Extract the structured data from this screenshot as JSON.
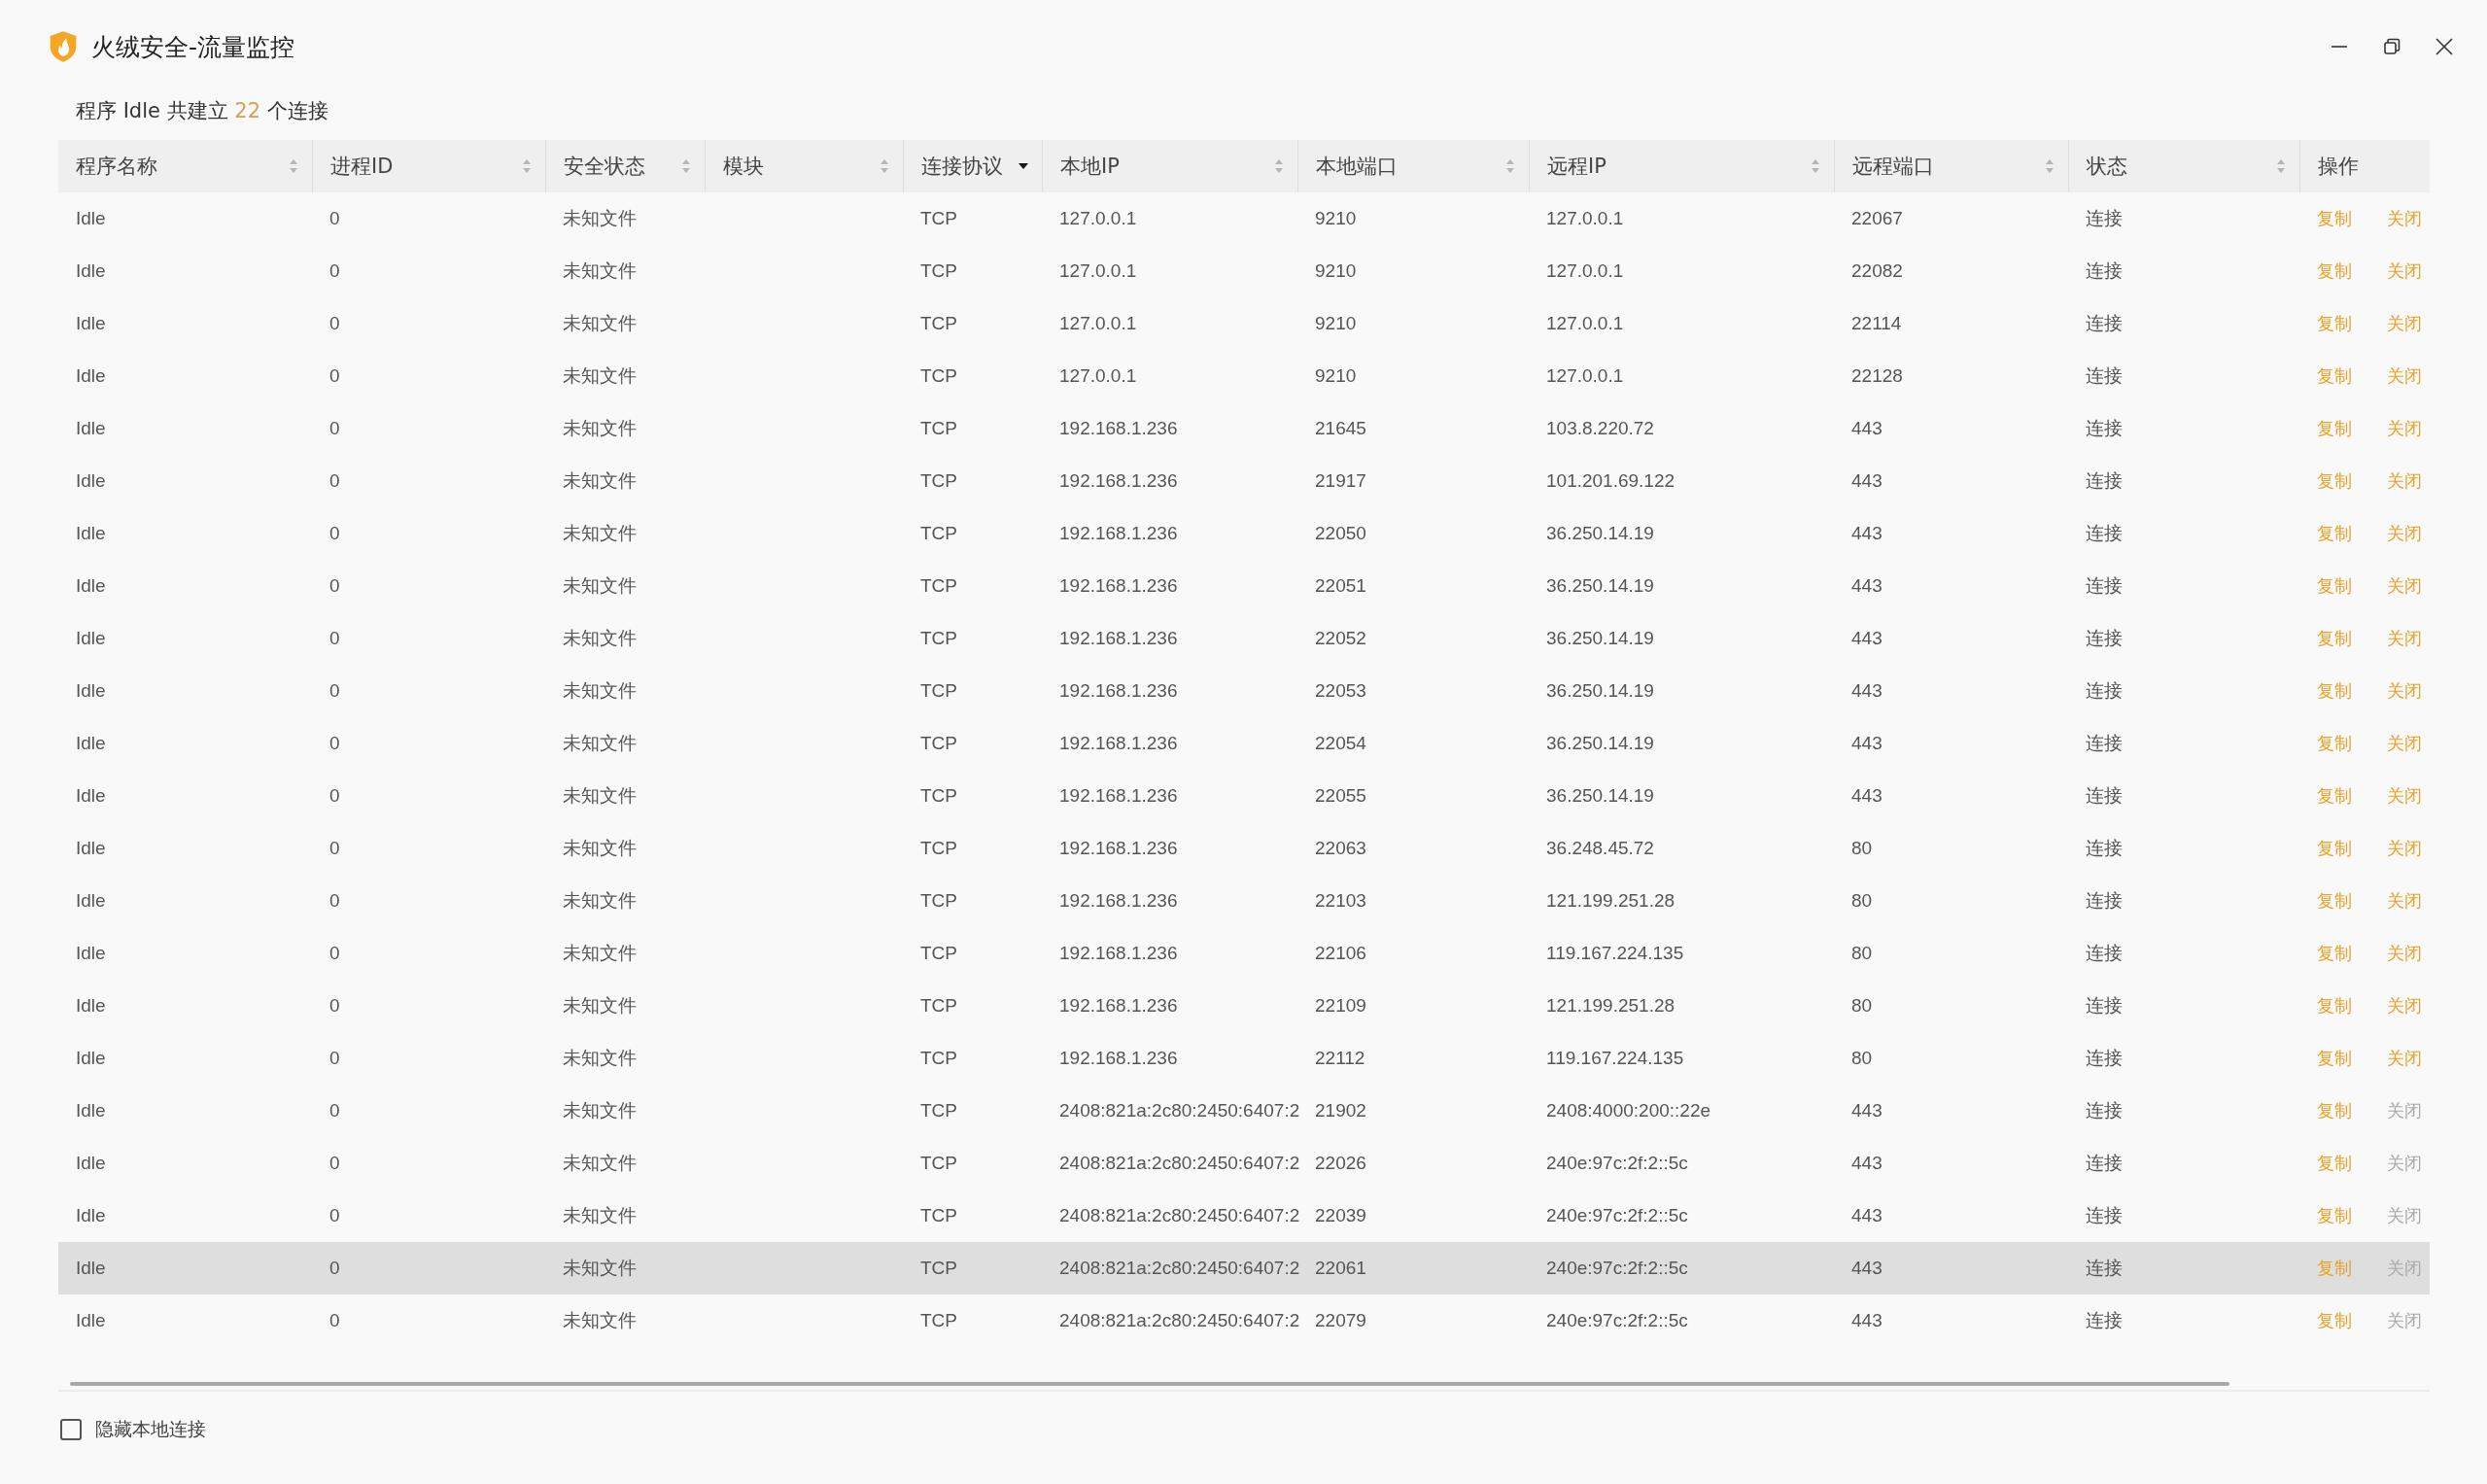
{
  "window": {
    "title": "火绒安全-流量监控"
  },
  "summary": {
    "prefix": "程序 Idle 共建立",
    "count": "22",
    "suffix": "个连接"
  },
  "table": {
    "columns": [
      {
        "label": "程序名称",
        "kind": "sortable",
        "sorted_descending": false
      },
      {
        "label": "进程ID",
        "kind": "sortable",
        "sorted_descending": false
      },
      {
        "label": "安全状态",
        "kind": "sortable",
        "sorted_descending": false
      },
      {
        "label": "模块",
        "kind": "sortable",
        "sorted_descending": false
      },
      {
        "label": "连接协议",
        "kind": "sortable",
        "sorted_descending": true
      },
      {
        "label": "本地IP",
        "kind": "sortable",
        "sorted_descending": false
      },
      {
        "label": "本地端口",
        "kind": "sortable",
        "sorted_descending": false
      },
      {
        "label": "远程IP",
        "kind": "sortable",
        "sorted_descending": false
      },
      {
        "label": "远程端口",
        "kind": "sortable",
        "sorted_descending": false
      },
      {
        "label": "状态",
        "kind": "sortable",
        "sorted_descending": false
      },
      {
        "label": "操作",
        "kind": "plain"
      }
    ],
    "rows": [
      {
        "cells": [
          "Idle",
          "0",
          "未知文件",
          "",
          "TCP",
          "127.0.0.1",
          "9210",
          "127.0.0.1",
          "22067",
          "连接"
        ],
        "copy": "复制",
        "close": "关闭",
        "close_disabled": false,
        "selected": false
      },
      {
        "cells": [
          "Idle",
          "0",
          "未知文件",
          "",
          "TCP",
          "127.0.0.1",
          "9210",
          "127.0.0.1",
          "22082",
          "连接"
        ],
        "copy": "复制",
        "close": "关闭",
        "close_disabled": false,
        "selected": false
      },
      {
        "cells": [
          "Idle",
          "0",
          "未知文件",
          "",
          "TCP",
          "127.0.0.1",
          "9210",
          "127.0.0.1",
          "22114",
          "连接"
        ],
        "copy": "复制",
        "close": "关闭",
        "close_disabled": false,
        "selected": false
      },
      {
        "cells": [
          "Idle",
          "0",
          "未知文件",
          "",
          "TCP",
          "127.0.0.1",
          "9210",
          "127.0.0.1",
          "22128",
          "连接"
        ],
        "copy": "复制",
        "close": "关闭",
        "close_disabled": false,
        "selected": false
      },
      {
        "cells": [
          "Idle",
          "0",
          "未知文件",
          "",
          "TCP",
          "192.168.1.236",
          "21645",
          "103.8.220.72",
          "443",
          "连接"
        ],
        "copy": "复制",
        "close": "关闭",
        "close_disabled": false,
        "selected": false
      },
      {
        "cells": [
          "Idle",
          "0",
          "未知文件",
          "",
          "TCP",
          "192.168.1.236",
          "21917",
          "101.201.69.122",
          "443",
          "连接"
        ],
        "copy": "复制",
        "close": "关闭",
        "close_disabled": false,
        "selected": false
      },
      {
        "cells": [
          "Idle",
          "0",
          "未知文件",
          "",
          "TCP",
          "192.168.1.236",
          "22050",
          "36.250.14.19",
          "443",
          "连接"
        ],
        "copy": "复制",
        "close": "关闭",
        "close_disabled": false,
        "selected": false
      },
      {
        "cells": [
          "Idle",
          "0",
          "未知文件",
          "",
          "TCP",
          "192.168.1.236",
          "22051",
          "36.250.14.19",
          "443",
          "连接"
        ],
        "copy": "复制",
        "close": "关闭",
        "close_disabled": false,
        "selected": false
      },
      {
        "cells": [
          "Idle",
          "0",
          "未知文件",
          "",
          "TCP",
          "192.168.1.236",
          "22052",
          "36.250.14.19",
          "443",
          "连接"
        ],
        "copy": "复制",
        "close": "关闭",
        "close_disabled": false,
        "selected": false
      },
      {
        "cells": [
          "Idle",
          "0",
          "未知文件",
          "",
          "TCP",
          "192.168.1.236",
          "22053",
          "36.250.14.19",
          "443",
          "连接"
        ],
        "copy": "复制",
        "close": "关闭",
        "close_disabled": false,
        "selected": false
      },
      {
        "cells": [
          "Idle",
          "0",
          "未知文件",
          "",
          "TCP",
          "192.168.1.236",
          "22054",
          "36.250.14.19",
          "443",
          "连接"
        ],
        "copy": "复制",
        "close": "关闭",
        "close_disabled": false,
        "selected": false
      },
      {
        "cells": [
          "Idle",
          "0",
          "未知文件",
          "",
          "TCP",
          "192.168.1.236",
          "22055",
          "36.250.14.19",
          "443",
          "连接"
        ],
        "copy": "复制",
        "close": "关闭",
        "close_disabled": false,
        "selected": false
      },
      {
        "cells": [
          "Idle",
          "0",
          "未知文件",
          "",
          "TCP",
          "192.168.1.236",
          "22063",
          "36.248.45.72",
          "80",
          "连接"
        ],
        "copy": "复制",
        "close": "关闭",
        "close_disabled": false,
        "selected": false
      },
      {
        "cells": [
          "Idle",
          "0",
          "未知文件",
          "",
          "TCP",
          "192.168.1.236",
          "22103",
          "121.199.251.28",
          "80",
          "连接"
        ],
        "copy": "复制",
        "close": "关闭",
        "close_disabled": false,
        "selected": false
      },
      {
        "cells": [
          "Idle",
          "0",
          "未知文件",
          "",
          "TCP",
          "192.168.1.236",
          "22106",
          "119.167.224.135",
          "80",
          "连接"
        ],
        "copy": "复制",
        "close": "关闭",
        "close_disabled": false,
        "selected": false
      },
      {
        "cells": [
          "Idle",
          "0",
          "未知文件",
          "",
          "TCP",
          "192.168.1.236",
          "22109",
          "121.199.251.28",
          "80",
          "连接"
        ],
        "copy": "复制",
        "close": "关闭",
        "close_disabled": false,
        "selected": false
      },
      {
        "cells": [
          "Idle",
          "0",
          "未知文件",
          "",
          "TCP",
          "192.168.1.236",
          "22112",
          "119.167.224.135",
          "80",
          "连接"
        ],
        "copy": "复制",
        "close": "关闭",
        "close_disabled": false,
        "selected": false
      },
      {
        "cells": [
          "Idle",
          "0",
          "未知文件",
          "",
          "TCP",
          "2408:821a:2c80:2450:6407:2",
          "21902",
          "2408:4000:200::22e",
          "443",
          "连接"
        ],
        "copy": "复制",
        "close": "关闭",
        "close_disabled": true,
        "selected": false
      },
      {
        "cells": [
          "Idle",
          "0",
          "未知文件",
          "",
          "TCP",
          "2408:821a:2c80:2450:6407:2",
          "22026",
          "240e:97c:2f:2::5c",
          "443",
          "连接"
        ],
        "copy": "复制",
        "close": "关闭",
        "close_disabled": true,
        "selected": false
      },
      {
        "cells": [
          "Idle",
          "0",
          "未知文件",
          "",
          "TCP",
          "2408:821a:2c80:2450:6407:2",
          "22039",
          "240e:97c:2f:2::5c",
          "443",
          "连接"
        ],
        "copy": "复制",
        "close": "关闭",
        "close_disabled": true,
        "selected": false
      },
      {
        "cells": [
          "Idle",
          "0",
          "未知文件",
          "",
          "TCP",
          "2408:821a:2c80:2450:6407:2",
          "22061",
          "240e:97c:2f:2::5c",
          "443",
          "连接"
        ],
        "copy": "复制",
        "close": "关闭",
        "close_disabled": true,
        "selected": true
      },
      {
        "cells": [
          "Idle",
          "0",
          "未知文件",
          "",
          "TCP",
          "2408:821a:2c80:2450:6407:2",
          "22079",
          "240e:97c:2f:2::5c",
          "443",
          "连接"
        ],
        "copy": "复制",
        "close": "关闭",
        "close_disabled": true,
        "selected": false
      }
    ]
  },
  "footer": {
    "checkbox": {
      "label": "隐藏本地连接",
      "checked": false
    }
  }
}
